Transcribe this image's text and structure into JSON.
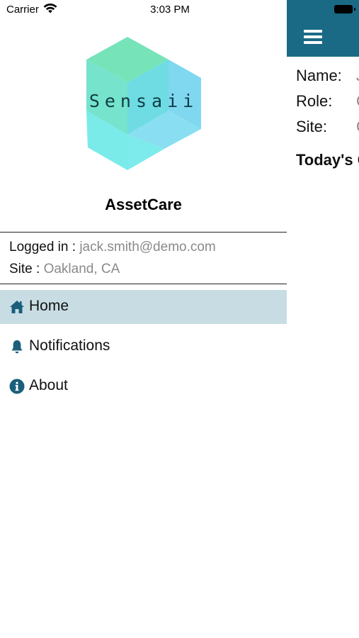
{
  "status_bar": {
    "carrier": "Carrier",
    "time": "3:03 PM"
  },
  "drawer": {
    "logo_text": "Sensaii",
    "app_name": "AssetCare",
    "logged_in_label": "Logged in : ",
    "logged_in_value": "jack.smith@demo.com",
    "site_label": "Site : ",
    "site_value": "Oakland, CA",
    "menu": [
      {
        "label": "Home",
        "icon": "home-icon",
        "active": true
      },
      {
        "label": "Notifications",
        "icon": "bell-icon",
        "active": false
      },
      {
        "label": "About",
        "icon": "info-icon",
        "active": false
      }
    ]
  },
  "background_screen": {
    "name_label": "Name:",
    "name_value": "J",
    "role_label": "Role:",
    "role_value": "C",
    "site_label": "Site:",
    "site_value": "C",
    "today_heading": "Today's C"
  },
  "colors": {
    "header": "#1b6a85",
    "active_item": "#c8dde3",
    "icon": "#1b5f7a",
    "secondary_text": "#8a8a8a",
    "logo_green": "#6fe3b4",
    "logo_cyan": "#5fe6ea",
    "logo_blue": "#6fd0ee"
  }
}
